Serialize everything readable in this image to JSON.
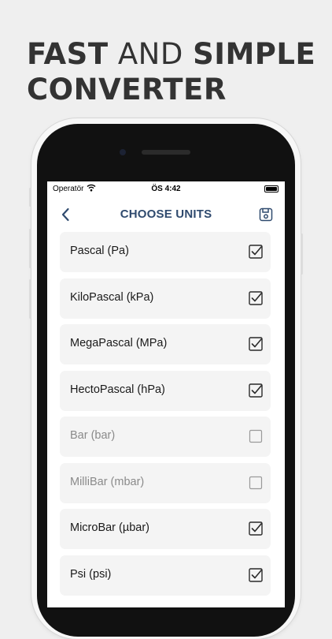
{
  "headline": {
    "line1": [
      {
        "text": "FAST",
        "weight": "bold"
      },
      {
        "text": " AND ",
        "weight": "light"
      },
      {
        "text": "SIMPLE",
        "weight": "bold"
      }
    ],
    "line2": "CONVERTER"
  },
  "status_bar": {
    "carrier": "Operatör",
    "time": "ÖS 4:42"
  },
  "navbar": {
    "title": "CHOOSE UNITS",
    "back_icon": "chevron-left-icon",
    "save_icon": "save-icon"
  },
  "colors": {
    "accent": "#2f4a6e",
    "background": "#efefef",
    "row_background": "#f4f4f4",
    "disabled_text": "#8a8a8a"
  },
  "units": [
    {
      "label": "Pascal (Pa)",
      "checked": true
    },
    {
      "label": "KiloPascal (kPa)",
      "checked": true
    },
    {
      "label": "MegaPascal (MPa)",
      "checked": true
    },
    {
      "label": "HectoPascal (hPa)",
      "checked": true
    },
    {
      "label": "Bar (bar)",
      "checked": false
    },
    {
      "label": "MilliBar (mbar)",
      "checked": false
    },
    {
      "label": "MicroBar (µbar)",
      "checked": true
    },
    {
      "label": "Psi (psi)",
      "checked": true
    }
  ]
}
